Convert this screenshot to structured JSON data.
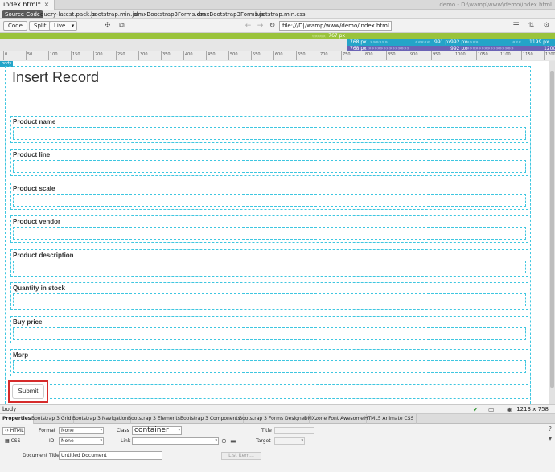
{
  "window": {
    "doc_tab": "index.html*",
    "path": "demo - D:\\wamp\\www\\demo\\index.html"
  },
  "related_files": [
    "Source Code",
    "jquery-latest.pack.js",
    "bootstrap.min.js",
    "dmxBootstrap3Forms.css",
    "dmxBootstrap3Forms.js",
    "bootstrap.min.css"
  ],
  "toolbar": {
    "code": "Code",
    "split": "Split",
    "live": "Live",
    "address": "file:///D|/wamp/www/demo/index.html"
  },
  "media_queries": {
    "green_label": "767 px",
    "teal_labels": [
      "768 px",
      "991 px",
      "992 px",
      "1199 px"
    ],
    "purple_labels": [
      "768 px",
      "992 px",
      "1200"
    ]
  },
  "ruler": [
    "0",
    "50",
    "100",
    "150",
    "200",
    "250",
    "300",
    "350",
    "400",
    "450",
    "500",
    "550",
    "600",
    "650",
    "700",
    "750",
    "800",
    "850",
    "900",
    "950",
    "1000",
    "1050",
    "1100",
    "1150",
    "1200"
  ],
  "canvas": {
    "body_tag": "body",
    "title": "Insert Record",
    "fields": [
      "Product name",
      "Product line",
      "Product scale",
      "Product vendor",
      "Product description",
      "Quantity in stock",
      "Buy price",
      "Msrp"
    ],
    "submit": "Submit"
  },
  "status": {
    "tag": "body",
    "dimensions": "1213 x 758"
  },
  "panel_tabs": [
    "Properties",
    "Bootstrap 3 Grid",
    "Bootstrap 3 Navigation",
    "Bootstrap 3 Elements",
    "Bootstrap 3 Components",
    "Bootstrap 3 Forms Designer",
    "DMXzone Font Awesome",
    "HTML5 Animate CSS"
  ],
  "properties": {
    "html_mode": "HTML",
    "css_mode": "CSS",
    "format_label": "Format",
    "format_value": "None",
    "id_label": "ID",
    "id_value": "None",
    "class_label": "Class",
    "class_value": "container",
    "link_label": "Link",
    "title_label": "Title",
    "target_label": "Target",
    "doc_title_label": "Document Title",
    "doc_title_value": "Untitled Document",
    "list_item": "List Item..."
  }
}
